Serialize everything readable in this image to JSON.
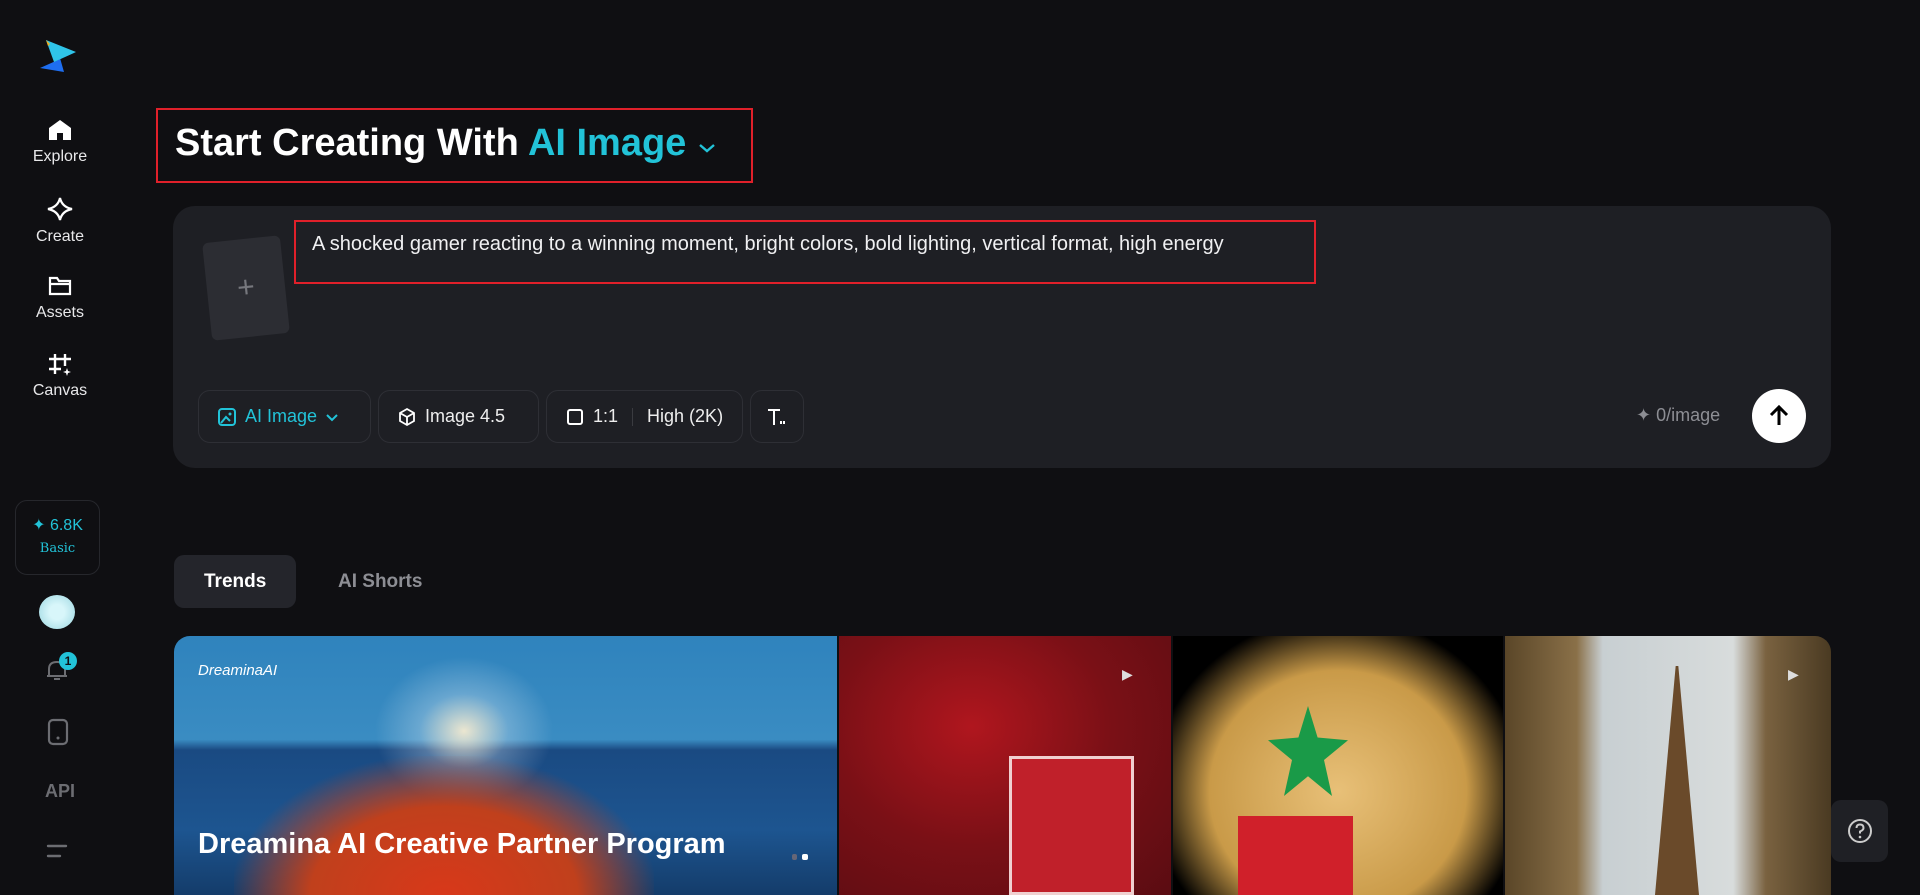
{
  "sidebar": {
    "nav": [
      {
        "label": "Explore",
        "icon": "home-icon"
      },
      {
        "label": "Create",
        "icon": "sparkle-icon"
      },
      {
        "label": "Assets",
        "icon": "folder-icon"
      },
      {
        "label": "Canvas",
        "icon": "canvas-icon"
      }
    ],
    "credits": {
      "value": "✦ 6.8K",
      "plan": "Basic"
    },
    "notification_count": "1",
    "api_label": "API"
  },
  "header": {
    "title_prefix": "Start Creating With",
    "title_mode": "AI Image"
  },
  "prompt": {
    "text": "A shocked gamer reacting to a winning moment, bright colors, bold lighting, vertical format, high energy",
    "upload_symbol": "+"
  },
  "toolbar": {
    "mode": "AI Image",
    "model": "Image 4.5",
    "ratio": "1:1",
    "quality": "High (2K)",
    "cost": "✦ 0/image"
  },
  "tabs": [
    {
      "label": "Trends",
      "active": true
    },
    {
      "label": "AI Shorts",
      "active": false
    }
  ],
  "feed": {
    "banner_logo": "DreaminaAI",
    "banner_title": "Dreamina AI Creative Partner Program"
  },
  "colors": {
    "accent": "#22c3d8",
    "background": "#0f0f12",
    "card": "#1e1f24",
    "highlight": "#e0202a"
  }
}
